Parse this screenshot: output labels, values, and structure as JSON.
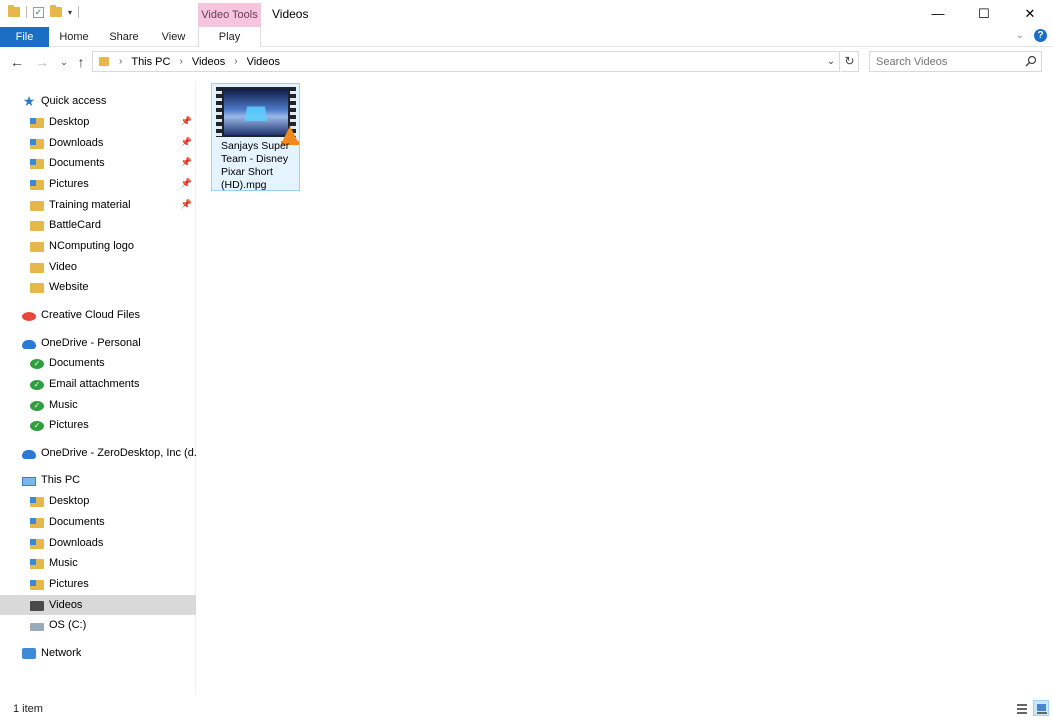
{
  "window": {
    "title": "Videos",
    "context_tab_group": "Video Tools",
    "buttons": {
      "minimize": "—",
      "maximize": "☐",
      "close": "✕"
    }
  },
  "ribbon": {
    "tabs": [
      "File",
      "Home",
      "Share",
      "View",
      "Play"
    ],
    "active_tab": "File"
  },
  "address": {
    "crumbs": [
      "This PC",
      "Videos",
      "Videos"
    ],
    "search_placeholder": "Search Videos"
  },
  "nav": {
    "quick_access": {
      "label": "Quick access",
      "items": [
        {
          "label": "Desktop",
          "pinned": true
        },
        {
          "label": "Downloads",
          "pinned": true
        },
        {
          "label": "Documents",
          "pinned": true
        },
        {
          "label": "Pictures",
          "pinned": true
        },
        {
          "label": "Training material",
          "pinned": true
        },
        {
          "label": "BattleCard",
          "pinned": false
        },
        {
          "label": "NComputing logo",
          "pinned": false
        },
        {
          "label": "Video",
          "pinned": false
        },
        {
          "label": "Website",
          "pinned": false
        }
      ]
    },
    "creative_cloud": {
      "label": "Creative Cloud Files"
    },
    "onedrive_personal": {
      "label": "OneDrive - Personal",
      "items": [
        "Documents",
        "Email attachments",
        "Music",
        "Pictures"
      ]
    },
    "onedrive_business": {
      "label": "OneDrive - ZeroDesktop, Inc (d.b.a"
    },
    "this_pc": {
      "label": "This PC",
      "items": [
        "Desktop",
        "Documents",
        "Downloads",
        "Music",
        "Pictures",
        "Videos",
        "OS (C:)"
      ],
      "selected": "Videos"
    },
    "network": {
      "label": "Network"
    }
  },
  "content": {
    "files": [
      {
        "name": "Sanjays Super Team - Disney Pixar Short (HD).mpg",
        "name_lines": [
          "Sanjays Super",
          "Team - Disney",
          "Pixar Short",
          "(HD).mpg"
        ],
        "type": "video-file-icon"
      }
    ]
  },
  "status": {
    "item_count": "1 item"
  },
  "colors": {
    "file_tab": "#1a6fc4",
    "context_tab": "#f5c5de",
    "selection": "#e5f3ff",
    "selection_border": "#99d1ff",
    "nav_selected": "#d9d9d9"
  }
}
